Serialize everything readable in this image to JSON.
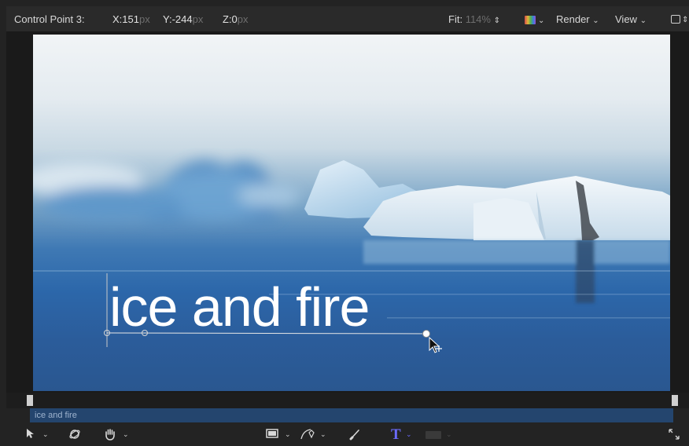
{
  "header": {
    "control_point": "Control Point 3:",
    "x_label": "X:151",
    "x_unit": "px",
    "y_label": "Y:-244",
    "y_unit": "px",
    "z_label": "Z:0",
    "z_unit": "px",
    "fit_label": "Fit:",
    "fit_value": "114%",
    "render_label": "Render",
    "view_label": "View"
  },
  "canvas": {
    "title_text": "ice and fire"
  },
  "timeline": {
    "clip_label": "ice and fire"
  },
  "toolbar": {
    "select_tool": "select-arrow-icon",
    "orbit_tool": "3d-orbit-icon",
    "pan_tool": "hand-icon",
    "shape_tool": "rectangle-icon",
    "pen_tool": "bezier-pen-icon",
    "paint_tool": "paint-stroke-icon",
    "text_tool": "T",
    "mask_tool": "mask-icon",
    "fullscreen": "expand-icon",
    "text_tool_color": "#6b6bff"
  }
}
